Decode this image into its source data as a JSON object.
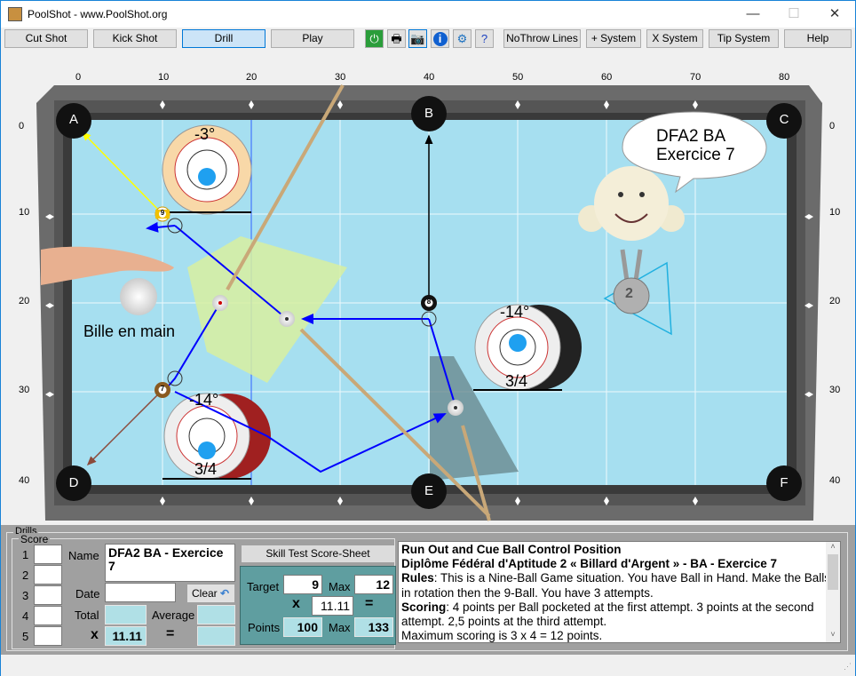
{
  "window": {
    "title": "PoolShot - www.PoolShot.org",
    "minimize": "—",
    "maximize": "☐",
    "close": "✕"
  },
  "toolbar": {
    "buttons": [
      "Cut Shot",
      "Kick Shot",
      "Drill",
      "Play"
    ],
    "selected": "Drill",
    "icons": [
      "power-icon",
      "printer-icon",
      "camera-icon",
      "info-icon",
      "gear-icon",
      "help-document-icon"
    ],
    "buttons2": [
      "NoThrow Lines",
      "+ System",
      "X System",
      "Tip System",
      "Help"
    ]
  },
  "table": {
    "x_ticks": [
      "0",
      "10",
      "20",
      "30",
      "40",
      "50",
      "60",
      "70",
      "80"
    ],
    "y_ticks": [
      "0",
      "10",
      "20",
      "30",
      "40"
    ],
    "pockets": [
      "A",
      "B",
      "C",
      "D",
      "E",
      "F"
    ],
    "balls": {
      "nine": "9",
      "eight": "8",
      "seven": "7"
    },
    "spin_diagrams": [
      {
        "angle": "-3°",
        "fraction": ""
      },
      {
        "angle": "-14°",
        "fraction": "3/4"
      },
      {
        "angle": "-14°",
        "fraction": "3/4"
      }
    ],
    "bubble": {
      "line1": "DFA2 BA",
      "line2": "Exercice 7"
    },
    "medal": "2",
    "ball_in_hand_label": "Bille en main",
    "colors": {
      "felt": "#a6dff0",
      "rail": "#4a4a4a",
      "path": "#0000ff",
      "aim": "#ffff00"
    }
  },
  "drills": {
    "group_label": "Drills",
    "score_label": "Score",
    "rows": [
      "1",
      "2",
      "3",
      "4",
      "5"
    ],
    "name_label": "Name",
    "name_value": "DFA2 BA - Exercice 7",
    "date_label": "Date",
    "date_value": "",
    "clear_label": "Clear",
    "total_label": "Total",
    "total_value": "",
    "average_label": "Average",
    "average_value": "",
    "x_label": "x",
    "multiplier": "11.11",
    "eq": "=",
    "result": "",
    "score_sheet_button": "Skill Test Score-Sheet",
    "sheet": {
      "target_label": "Target",
      "target": "9",
      "max_label": "Max",
      "max": "12",
      "x": "x",
      "multiplier": "11.11",
      "eq": "=",
      "points_label": "Points",
      "points": "100",
      "max2_label": "Max",
      "max2": "133"
    }
  },
  "description": {
    "title": "Run Out and Cue Ball Control Position",
    "subtitle": "Diplôme Fédéral d'Aptitude 2 « Billard d'Argent » - BA - Exercice 7",
    "rules_label": "Rules",
    "rules": ": This is a Nine-Ball Game situation. You have Ball in Hand. Make the Balls in rotation then the 9-Ball. You have 3 attempts.",
    "scoring_label": "Scoring",
    "scoring": ": 4 points per Ball pocketed at the first attempt. 3 points at the second attempt. 2,5 points at the third attempt.",
    "max_line": "Maximum scoring is 3 x 4 = 12 points."
  }
}
